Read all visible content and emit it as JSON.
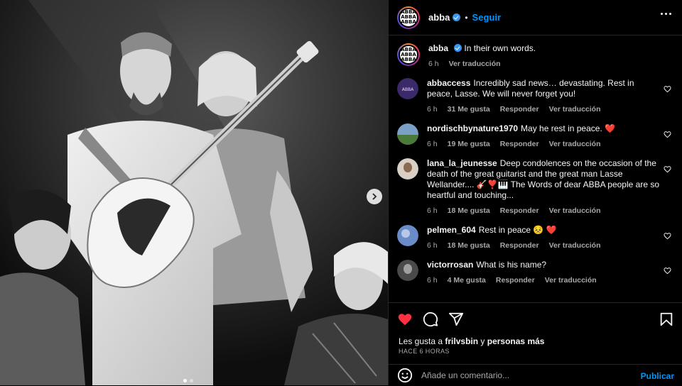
{
  "post": {
    "author": "abba",
    "follow_label": "Seguir",
    "sep": "•",
    "caption": {
      "username": "abba",
      "text": "In their own words.",
      "time": "6 h",
      "translate": "Ver traducción"
    }
  },
  "comments": [
    {
      "username": "abbaccess",
      "text": "Incredibly sad news… devastating. Rest in peace, Lasse. We will never forget you!",
      "time": "6 h",
      "likes": "31 Me gusta",
      "reply": "Responder",
      "translate": "Ver traducción"
    },
    {
      "username": "nordischbynature1970",
      "text": "May he rest in peace. ❤️",
      "time": "6 h",
      "likes": "19 Me gusta",
      "reply": "Responder",
      "translate": "Ver traducción"
    },
    {
      "username": "lana_la_jeunesse",
      "text": "Deep condolences on the occasion of the death of the great guitarist and the great man Lasse Wellander.... 🎸❣️🎹 The Words of dear ABBA people are so heartful and touching...",
      "time": "6 h",
      "likes": "18 Me gusta",
      "reply": "Responder",
      "translate": "Ver traducción"
    },
    {
      "username": "pelmen_604",
      "text": "Rest in peace 😣 ❤️",
      "time": "6 h",
      "likes": "18 Me gusta",
      "reply": "Responder",
      "translate": "Ver traducción"
    },
    {
      "username": "victorrosan",
      "text": "What is his name?",
      "time": "6 h",
      "likes": "4 Me gusta",
      "reply": "Responder",
      "translate": "Ver traducción"
    }
  ],
  "likes_line": {
    "prefix": "Les gusta a ",
    "user": "frilvsbin",
    "middle": " y ",
    "others": "personas más"
  },
  "timestamp": "HACE 6 HORAS",
  "add_comment": {
    "placeholder": "Añade un comentario...",
    "publish": "Publicar"
  },
  "carousel": {
    "slides": 2,
    "active": 0
  },
  "colors": {
    "accent": "#0095f6",
    "like_red": "#ff3040",
    "secondary_text": "#a8a8a8",
    "divider": "#262626"
  },
  "icons": [
    "verified-icon",
    "more-options-icon",
    "heart-icon",
    "comment-icon",
    "share-icon",
    "save-icon",
    "emoji-icon",
    "next-slide-icon"
  ]
}
